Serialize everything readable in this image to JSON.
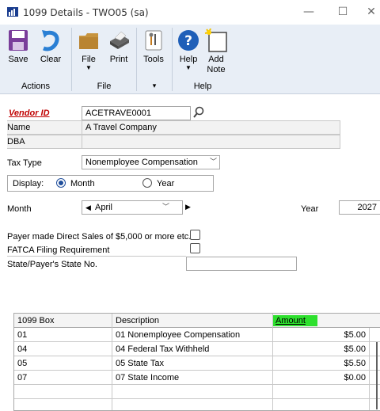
{
  "window": {
    "title": "1099 Details  -  TWO05 (sa)",
    "minimize": "—",
    "maximize": "☐",
    "close": "✕"
  },
  "ribbon": {
    "save": "Save",
    "clear": "Clear",
    "file": "File",
    "print": "Print",
    "tools": "Tools",
    "help": "Help",
    "add_note_1": "Add",
    "add_note_2": "Note",
    "groups": {
      "actions": "Actions",
      "file": "File",
      "tools_arrow": "▾",
      "help": "Help"
    }
  },
  "form": {
    "vendor_id_label": "Vendor ID",
    "vendor_id_value": "ACETRAVE0001",
    "name_label": "Name",
    "name_value": "A Travel Company",
    "dba_label": "DBA",
    "dba_value": "",
    "tax_type_label": "Tax Type",
    "tax_type_value": "Nonemployee Compensation",
    "display_label": "Display:",
    "display_month": "Month",
    "display_year": "Year",
    "display_selected": "Month",
    "month_label": "Month",
    "month_value": "April",
    "year_label": "Year",
    "year_value": "2027",
    "payer_direct_sales_label": "Payer made Direct Sales of $5,000 or more etc.",
    "fatca_label": "FATCA Filing Requirement",
    "state_payer_label": "State/Payer's State No.",
    "state_payer_value": ""
  },
  "grid": {
    "columns": [
      "1099 Box",
      "Description",
      "Amount"
    ],
    "rows": [
      {
        "box": "01",
        "description": "01 Nonemployee Compensation",
        "amount": "$5.00"
      },
      {
        "box": "04",
        "description": "04 Federal Tax Withheld",
        "amount": "$5.00"
      },
      {
        "box": "05",
        "description": "05 State Tax",
        "amount": "$5.50"
      },
      {
        "box": "07",
        "description": "07 State Income",
        "amount": "$0.00"
      }
    ]
  },
  "colors": {
    "ribbon_bg": "#e8eef6",
    "vendor_label": "#c00000",
    "amount_highlight": "#2ee02e",
    "radio_accent": "#1f4e9c"
  }
}
